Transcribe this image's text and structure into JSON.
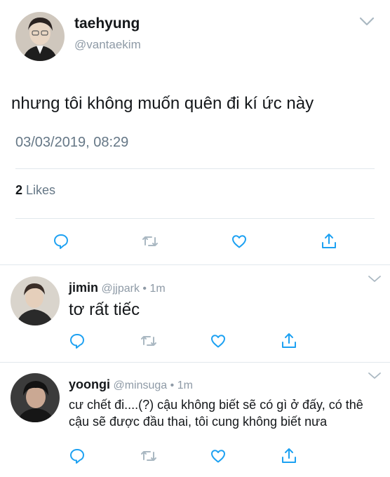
{
  "main_tweet": {
    "author_name": "taehyung",
    "author_handle": "@vantaekim",
    "text": "nhưng tôi không muốn quên đi kí ức này",
    "timestamp": "03/03/2019, 08:29",
    "likes_count": "2",
    "likes_label": "Likes"
  },
  "replies": [
    {
      "author_name": "jimin",
      "author_handle": "@jjpark",
      "separator": "•",
      "time": "1m",
      "text": "tơ rất tiếc"
    },
    {
      "author_name": "yoongi",
      "author_handle": "@minsuga",
      "separator": "•",
      "time": "1m",
      "text": "cư chết đi....(?) cậu không biết sẽ có gì ở đấy, có thê cậu sẽ được đầu thai, tôi cung không biết nưa"
    }
  ],
  "icons": {
    "reply": "reply-icon",
    "retweet": "retweet-icon",
    "like": "heart-icon",
    "share": "share-icon",
    "menu": "chevron-down-icon"
  },
  "colors": {
    "text": "#14171a",
    "muted": "#657786",
    "handle": "#8e9aa6",
    "divider": "#e1e8ed"
  }
}
